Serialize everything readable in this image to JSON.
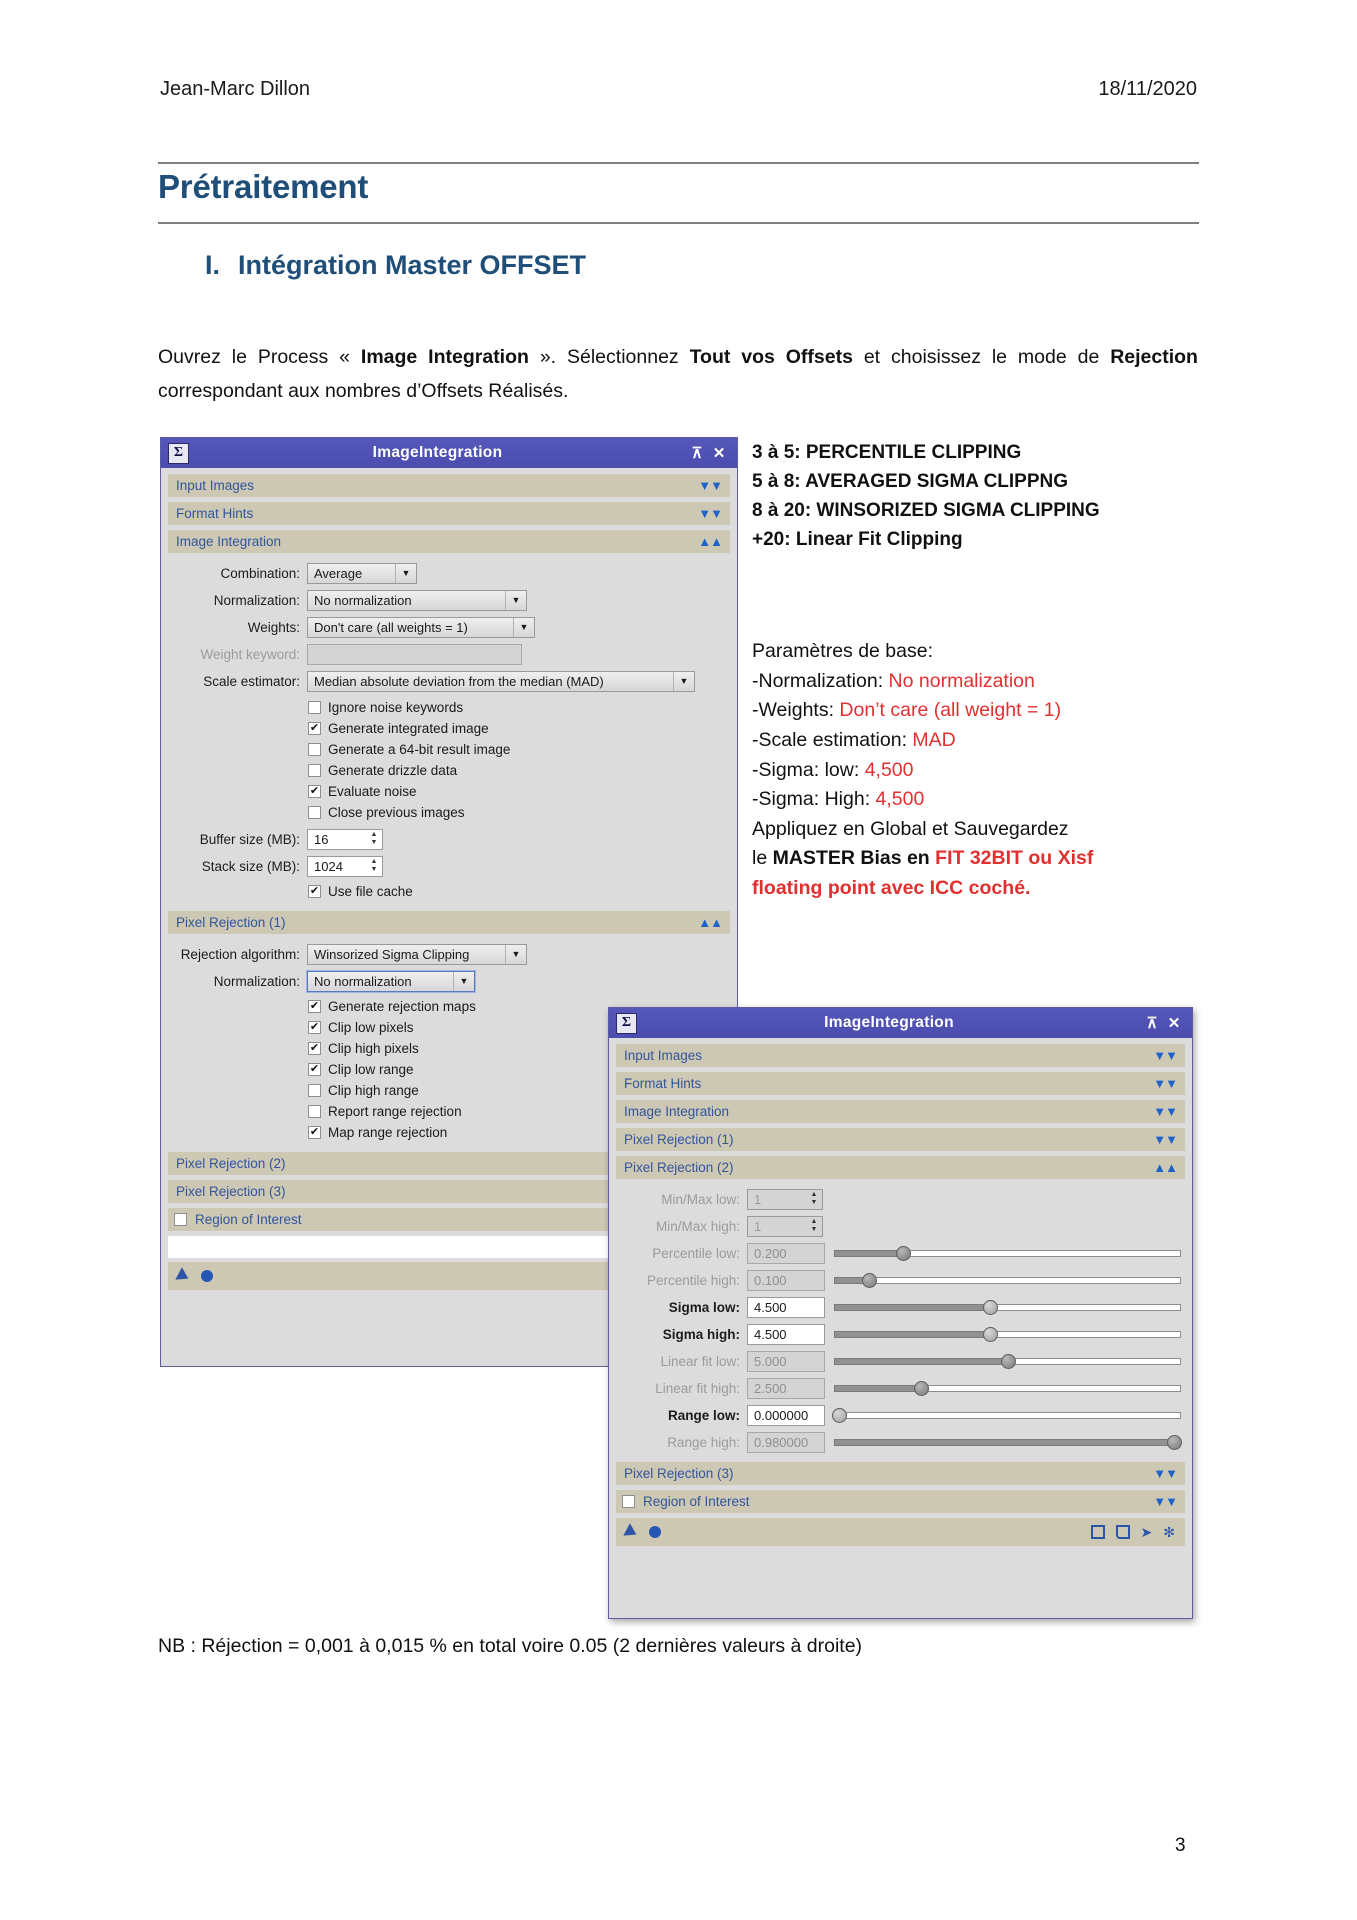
{
  "header": {
    "author": "Jean-Marc Dillon",
    "date": "18/11/2020"
  },
  "doc_title": "Prétraitement",
  "section": {
    "number": "I.",
    "title": "Intégration Master OFFSET"
  },
  "intro": {
    "p1_a": "Ouvrez le Process « ",
    "p1_b": "Image Integration",
    "p1_c": " ». Sélectionnez ",
    "p1_d": "Tout vos Offsets",
    "p1_e": " et choisissez le mode de ",
    "p1_f": "Rejection",
    "p1_g": " correspondant aux nombres d’Offsets Réalisés."
  },
  "clipping_notes": [
    "3 à 5: PERCENTILE CLIPPING",
    "5 à 8: AVERAGED SIGMA CLIPPNG",
    "8 à 20: WINSORIZED SIGMA CLIPPING",
    "+20: Linear Fit Clipping"
  ],
  "params_notes": {
    "title": "Paramètres de base:",
    "rows": [
      {
        "label": "-Normalization: ",
        "value": "No normalization"
      },
      {
        "label": "-Weights: ",
        "value": "Don’t care (all weight = 1)"
      },
      {
        "label": "-Scale estimation: ",
        "value": "MAD"
      },
      {
        "label": "-Sigma: low: ",
        "value": "4,500"
      },
      {
        "label": "-Sigma: High: ",
        "value": "4,500"
      }
    ],
    "closing_line1": "Appliquez en Global et Sauvegardez",
    "closing_line2_a": "le ",
    "closing_line2_b": "MASTER Bias en ",
    "closing_line2_c": "FIT 32BIT ou Xisf",
    "closing_line3": "floating point avec ICC coché."
  },
  "bottom_note": "NB : Réjection = 0,001 à 0,015 % en total voire 0.05 (2 dernières valeurs à droite)",
  "page_number": "3",
  "dialog1": {
    "title": "ImageIntegration",
    "icon": "Σ",
    "titlebar_buttons": {
      "roll": "⊼",
      "close": "✕"
    },
    "sections": [
      {
        "label": "Input Images",
        "arrow": "▼▼"
      },
      {
        "label": "Format Hints",
        "arrow": "▼▼"
      },
      {
        "label": "Image Integration",
        "arrow": "▲▲"
      }
    ],
    "integration": {
      "combination_label": "Combination:",
      "combination_value": "Average",
      "normalization_label": "Normalization:",
      "normalization_value": "No normalization",
      "weights_label": "Weights:",
      "weights_value": "Don't care (all weights = 1)",
      "weight_keyword_label": "Weight keyword:",
      "weight_keyword_value": "",
      "scale_estimator_label": "Scale estimator:",
      "scale_estimator_value": "Median absolute deviation from the median (MAD)",
      "checkboxes": [
        {
          "label": "Ignore noise keywords",
          "checked": false
        },
        {
          "label": "Generate integrated image",
          "checked": true
        },
        {
          "label": "Generate a 64-bit result image",
          "checked": false
        },
        {
          "label": "Generate drizzle data",
          "checked": false
        },
        {
          "label": "Evaluate noise",
          "checked": true
        },
        {
          "label": "Close previous images",
          "checked": false
        }
      ],
      "buffer_size_label": "Buffer size (MB):",
      "buffer_size_value": "16",
      "stack_size_label": "Stack size (MB):",
      "stack_size_value": "1024",
      "use_file_cache_label": "Use file cache",
      "use_file_cache_checked": true
    },
    "pixel_rejection_1": {
      "section_label": "Pixel Rejection (1)",
      "arrow": "▲▲",
      "rejection_algorithm_label": "Rejection algorithm:",
      "rejection_algorithm_value": "Winsorized Sigma Clipping",
      "normalization_label": "Normalization:",
      "normalization_value": "No normalization",
      "checkboxes": [
        {
          "label": "Generate rejection maps",
          "checked": true
        },
        {
          "label": "Clip low pixels",
          "checked": true
        },
        {
          "label": "Clip high pixels",
          "checked": true
        },
        {
          "label": "Clip low range",
          "checked": true
        },
        {
          "label": "Clip high range",
          "checked": false
        },
        {
          "label": "Report range rejection",
          "checked": false
        },
        {
          "label": "Map range rejection",
          "checked": true
        }
      ]
    },
    "trailing_sections": [
      {
        "label": "Pixel Rejection (2)",
        "arrow": ""
      },
      {
        "label": "Pixel Rejection (3)",
        "arrow": ""
      }
    ],
    "region_of_interest": {
      "label": "Region of Interest",
      "checked": false,
      "arrow": ""
    }
  },
  "dialog2": {
    "title": "ImageIntegration",
    "icon": "Σ",
    "titlebar_buttons": {
      "roll": "⊼",
      "close": "✕"
    },
    "sections": [
      {
        "label": "Input Images",
        "arrow": "▼▼"
      },
      {
        "label": "Format Hints",
        "arrow": "▼▼"
      },
      {
        "label": "Image Integration",
        "arrow": "▼▼"
      },
      {
        "label": "Pixel Rejection (1)",
        "arrow": "▼▼"
      },
      {
        "label": "Pixel Rejection (2)",
        "arrow": "▲▲"
      }
    ],
    "rejection2_rows": [
      {
        "label": "Min/Max low:",
        "value": "1",
        "type": "spin",
        "dim": true,
        "pct": null
      },
      {
        "label": "Min/Max high:",
        "value": "1",
        "type": "spin",
        "dim": true,
        "pct": null
      },
      {
        "label": "Percentile low:",
        "value": "0.200",
        "type": "slider",
        "dim": true,
        "pct": 20
      },
      {
        "label": "Percentile high:",
        "value": "0.100",
        "type": "slider",
        "dim": true,
        "pct": 10
      },
      {
        "label": "Sigma low:",
        "value": "4.500",
        "type": "slider",
        "dim": false,
        "pct": 45
      },
      {
        "label": "Sigma high:",
        "value": "4.500",
        "type": "slider",
        "dim": false,
        "pct": 45
      },
      {
        "label": "Linear fit low:",
        "value": "5.000",
        "type": "slider",
        "dim": true,
        "pct": 50
      },
      {
        "label": "Linear fit high:",
        "value": "2.500",
        "type": "slider",
        "dim": true,
        "pct": 25
      },
      {
        "label": "Range low:",
        "value": "0.000000",
        "type": "slider",
        "dim": false,
        "pct": 0
      },
      {
        "label": "Range high:",
        "value": "0.980000",
        "type": "slider",
        "dim": true,
        "pct": 98
      }
    ],
    "trailing_sections": [
      {
        "label": "Pixel Rejection (3)",
        "arrow": "▼▼"
      }
    ],
    "region_of_interest": {
      "label": "Region of Interest",
      "checked": false,
      "arrow": "▼▼"
    }
  },
  "colors": {
    "heading_blue": "#1f4e79",
    "accent_red": "#e03030",
    "titlebar_blue": "#4a4dae",
    "section_tan": "#cdc8b4",
    "section_text_blue": "#33559b"
  }
}
